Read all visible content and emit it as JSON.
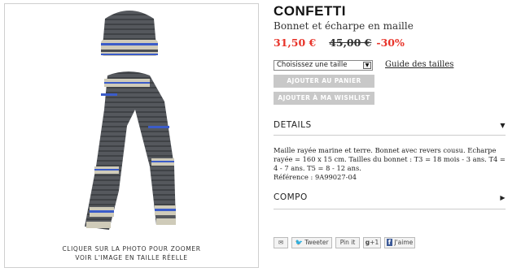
{
  "product": {
    "brand": "CONFETTI",
    "subtitle": "Bonnet et écharpe en maille",
    "price_new": "31,50 €",
    "price_old": "45,00 €",
    "discount": "-30%"
  },
  "photo": {
    "caption_line1": "CLIQUER SUR LA PHOTO POUR ZOOMER",
    "caption_line2": "VOIR L'IMAGE EN TAILLE RÉELLE"
  },
  "size": {
    "selected": "Choisissez une taille",
    "guide_label": "Guide des tailles"
  },
  "buttons": {
    "cart": "AJOUTER AU PANIER",
    "wishlist": "AJOUTER À MA WISHLIST"
  },
  "details": {
    "title": "DETAILS",
    "lines": [
      "Maille rayée marine et terre. Bonnet avec revers cousu. Echarpe",
      "rayée = 160 x 15 cm. Tailles du bonnet : T3 = 18 mois - 3 ans. T4 =",
      "4 - 7 ans. T5 = 8 - 12 ans.",
      "Référence : 9A99027-04"
    ]
  },
  "compo": {
    "title": "COMPO"
  },
  "share": {
    "tweeter": "Tweeter",
    "pinit": "Pin it",
    "gplus": "+1",
    "like": "J'aime"
  },
  "colors": {
    "price": "#e8342a",
    "button_disabled": "#c8c8c8",
    "knit_grey": "#4a4d52",
    "knit_blue": "#3b5cc9",
    "knit_beige": "#cfcbb9"
  }
}
